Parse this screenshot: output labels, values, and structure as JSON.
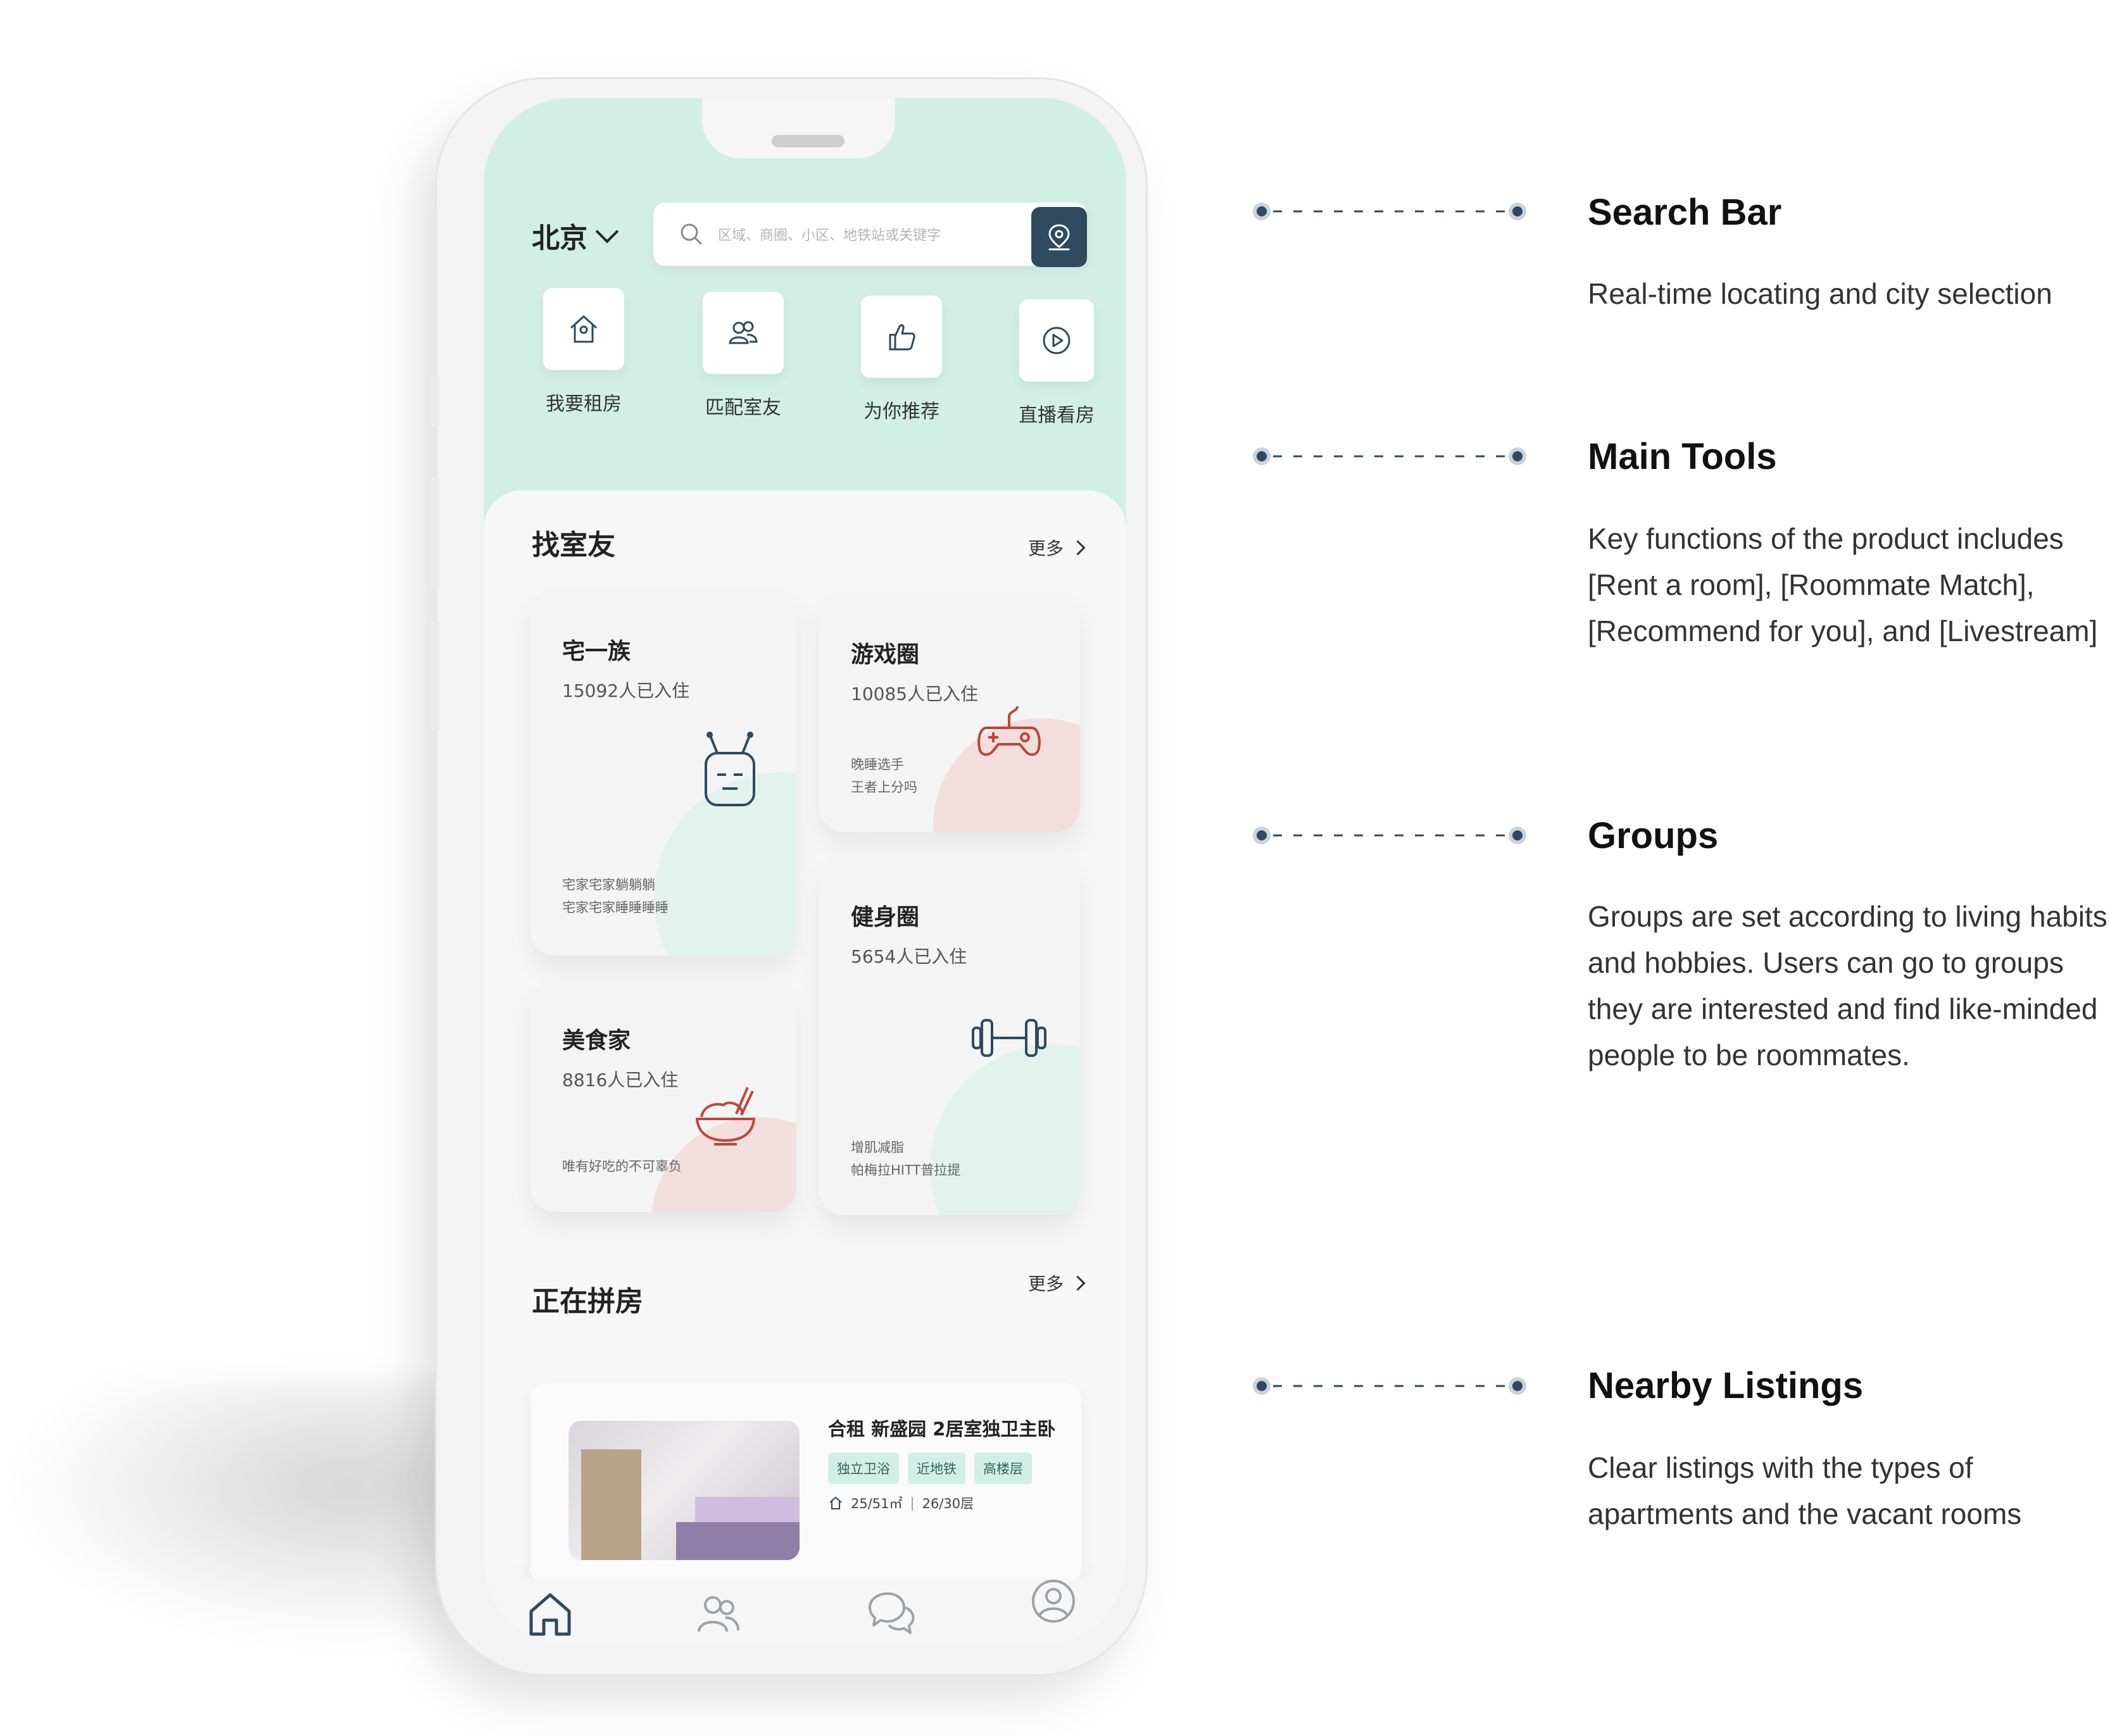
{
  "phone": {
    "city": "北京",
    "search_placeholder": "区域、商圈、小区、地铁站或关键字",
    "tools": [
      {
        "label": "我要租房",
        "icon": "house-icon"
      },
      {
        "label": "匹配室友",
        "icon": "people-icon"
      },
      {
        "label": "为你推荐",
        "icon": "thumbs-up-icon"
      },
      {
        "label": "直播看房",
        "icon": "play-icon"
      }
    ],
    "roommates": {
      "title": "找室友",
      "more": "更多",
      "groups": [
        {
          "name": "宅一族",
          "count": "15092人已入住",
          "desc": [
            "宅家宅家躺躺躺",
            "宅家宅家睡睡睡睡"
          ],
          "icon": "robot-icon"
        },
        {
          "name": "游戏圈",
          "count": "10085人已入住",
          "desc": [
            "晚睡选手",
            "王者上分吗"
          ],
          "icon": "gamepad-icon"
        },
        {
          "name": "美食家",
          "count": "8816人已入住",
          "desc": [
            "唯有好吃的不可辜负"
          ],
          "icon": "rice-bowl-icon"
        },
        {
          "name": "健身圈",
          "count": "5654人已入住",
          "desc": [
            "增肌减脂",
            "帕梅拉HITT普拉提"
          ],
          "icon": "dumbbell-icon"
        }
      ]
    },
    "sharing": {
      "title": "正在拼房",
      "more": "更多",
      "listing": {
        "title": "合租 新盛园 2居室独卫主卧",
        "tags": [
          "独立卫浴",
          "近地铁",
          "高楼层"
        ],
        "area": "25/51㎡",
        "floor": "26/30层"
      }
    },
    "tabbar": [
      "home-icon",
      "friends-icon",
      "chat-icon",
      "profile-icon"
    ]
  },
  "annotations": [
    {
      "title": "Search Bar",
      "desc": [
        "Real-time locating and city selection"
      ]
    },
    {
      "title": "Main Tools",
      "desc": [
        "Key functions of the product includes",
        "[Rent a room], [Roommate Match],",
        "[Recommend for you], and [Livestream]"
      ]
    },
    {
      "title": "Groups",
      "desc": [
        "Groups are set according to living habits",
        "and hobbies. Users can go to groups",
        "they are interested and find like-minded",
        "people to be roommates."
      ]
    },
    {
      "title": "Nearby Listings",
      "desc": [
        "Clear listings with the types of",
        "apartments and the vacant rooms"
      ]
    }
  ],
  "colors": {
    "mint": "#d2efe6",
    "navy": "#2f4a5e",
    "accent_red": "#c0453a",
    "pink_blob": "#f3dede"
  }
}
